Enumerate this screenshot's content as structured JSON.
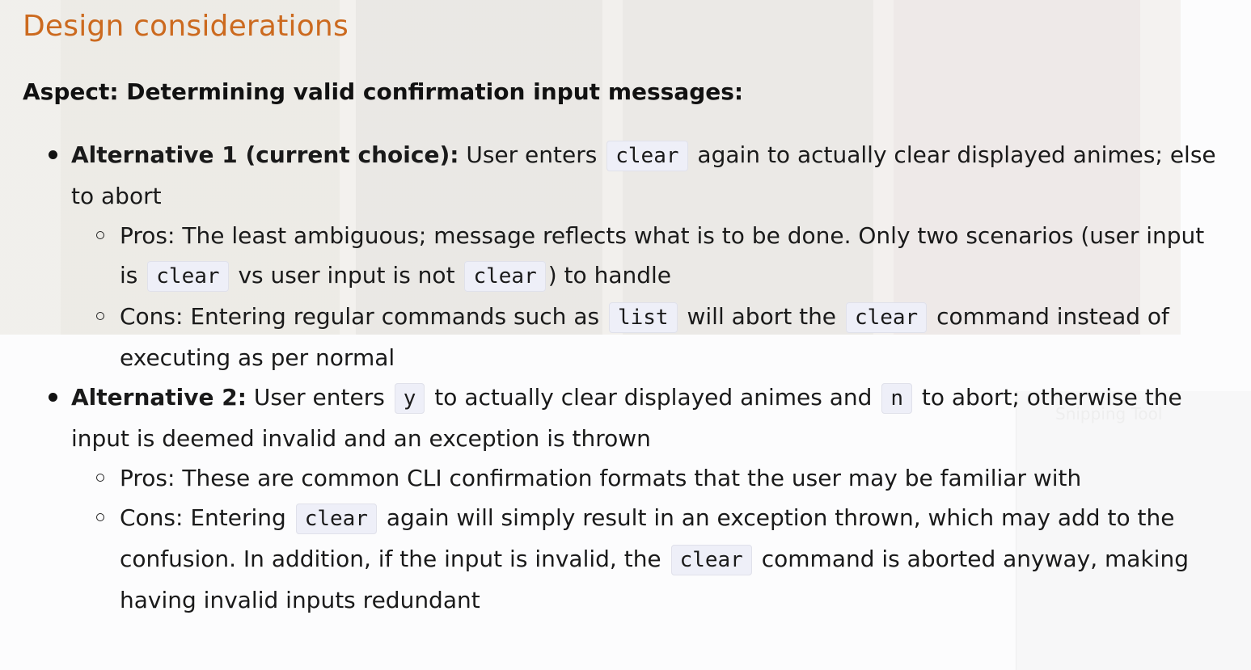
{
  "title": "Design considerations",
  "aspect": "Aspect: Determining valid confirmation input messages:",
  "alt1": {
    "label": "Alternative 1 (current choice):",
    "t1": " User enters ",
    "code1": "clear",
    "t2": " again to actually clear displayed animes; else to abort",
    "pros": {
      "t1": "Pros: The least ambiguous; message reflects what is to be done. Only two scenarios (user input is ",
      "code1": "clear",
      "t2": " vs user input is not ",
      "code2": "clear",
      "t3": ") to handle"
    },
    "cons": {
      "t1": "Cons: Entering regular commands such as ",
      "code1": "list",
      "t2": " will abort the ",
      "code2": "clear",
      "t3": " command instead of executing as per normal"
    }
  },
  "alt2": {
    "label": "Alternative 2:",
    "t1": " User enters ",
    "code1": "y",
    "t2": " to actually clear displayed animes and ",
    "code2": "n",
    "t3": " to abort; otherwise the input is deemed invalid and an exception is thrown",
    "pros": {
      "t1": "Pros: These are common CLI confirmation formats that the user may be familiar with"
    },
    "cons": {
      "t1": "Cons: Entering ",
      "code1": "clear",
      "t2": " again will simply result in an exception thrown, which may add to the confusion. In addition, if the input is invalid, the ",
      "code2": "clear",
      "t3": " command is aborted anyway, making having invalid inputs redundant"
    }
  },
  "background": {
    "ghost_text": "Snipping Tool"
  }
}
